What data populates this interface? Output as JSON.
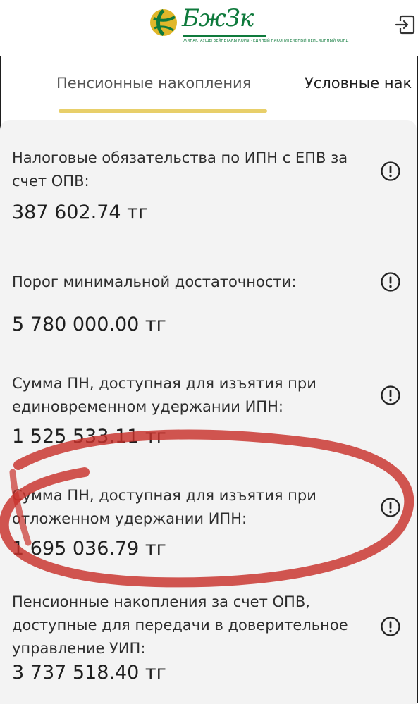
{
  "header": {
    "logo_text": "БжЗк",
    "logo_subtitle": "ЖИНАҚТАУШЫ ЗЕЙНЕТАҚЫ ҚОРЫ · ЕДИНЫЙ НАКОПИТЕЛЬНЫЙ ПЕНСИОННЫЙ ФОНД",
    "logout_icon": "logout-icon"
  },
  "tabs": [
    {
      "label": "Пенсионные накопления",
      "active": true
    },
    {
      "label": "Условные нак",
      "active": false
    }
  ],
  "colors": {
    "accent_underline": "#e8cf6a",
    "brand_green": "#0f7a3c",
    "annotation_red": "#c8312b"
  },
  "items": [
    {
      "label": "Налоговые обязательства по ИПН с ЕПВ за счет ОПВ:",
      "value": "387 602.74 тг",
      "icon": "info-icon"
    },
    {
      "label": "Порог минимальной достаточности:",
      "value": "5 780 000.00 тг",
      "icon": "info-icon"
    },
    {
      "label": "Сумма ПН, доступная для изъятия при единовременном удержании ИПН:",
      "value": "1 525 533.11 тг",
      "icon": "info-icon"
    },
    {
      "label": "Сумма ПН, доступная для изъятия при отложенном удержании ИПН:",
      "value": "1 695 036.79 тг",
      "icon": "info-icon"
    },
    {
      "label": "Пенсионные накопления за счет ОПВ, доступные для передачи в доверительное управление УИП:",
      "value": "3 737 518.40 тг",
      "icon": "info-icon"
    }
  ]
}
